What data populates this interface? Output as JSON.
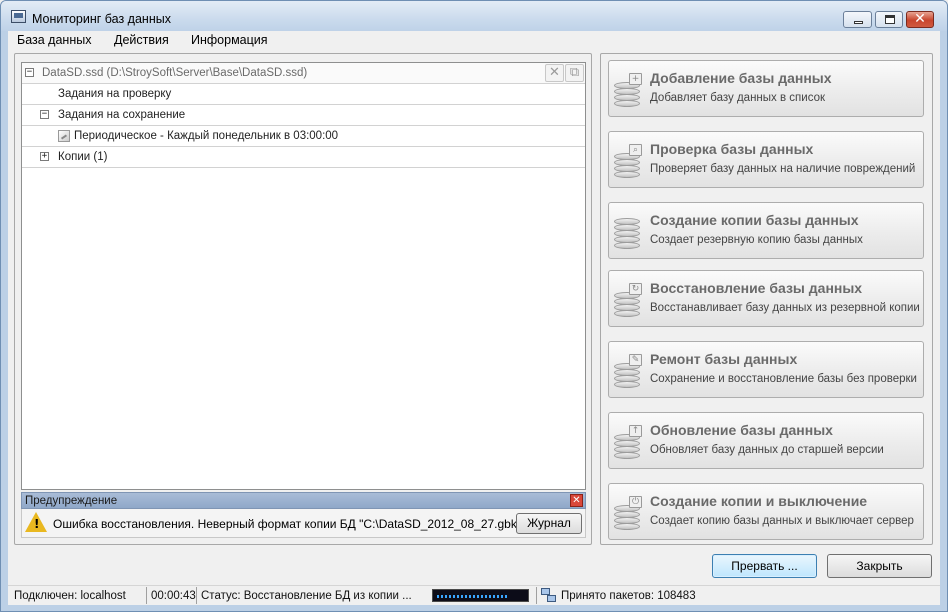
{
  "window": {
    "title": "Мониторинг баз данных",
    "close_glyph": "✕"
  },
  "menu": [
    "База данных",
    "Действия",
    "Информация"
  ],
  "tree": {
    "root": "DataSD.ssd (D:\\StroySoft\\Server\\Base\\DataSD.ssd)",
    "root_tools": [
      "✕",
      "⧉"
    ],
    "items": [
      "Задания на проверку",
      "Задания на сохранение",
      "Периодическое - Каждый понедельник в 03:00:00",
      "Копии (1)"
    ],
    "expander_minus": "−",
    "expander_plus": "+"
  },
  "warning": {
    "title": "Предупреждение",
    "close_glyph": "✕",
    "icon_mark": "!",
    "message": "Ошибка восстановления. Неверный формат копии БД \"C:\\DataSD_2012_08_27.gbk\"",
    "journal_button": "Журнал"
  },
  "actions": [
    {
      "title": "Добавление базы данных",
      "subtitle": "Добавляет базу данных в список",
      "badge": "+"
    },
    {
      "title": "Проверка базы данных",
      "subtitle": "Проверяет базу данных на наличие повреждений",
      "badge": "⌕"
    },
    {
      "title": "Создание копии базы данных",
      "subtitle": "Создает резервную копию базы данных",
      "badge": ""
    },
    {
      "title": "Восстановление базы данных",
      "subtitle": "Восстанавливает базу данных из резервной копии",
      "badge": "↻"
    },
    {
      "title": "Ремонт базы данных",
      "subtitle": "Сохранение и восстановление базы без проверки",
      "badge": "✎"
    },
    {
      "title": "Обновление базы данных",
      "subtitle": "Обновляет базу данных до старшей версии",
      "badge": "↑"
    },
    {
      "title": "Создание копии и выключение",
      "subtitle": "Создает копию базы данных и выключает сервер",
      "badge": "⏻"
    }
  ],
  "buttons": {
    "stop": "Прервать ...",
    "close": "Закрыть"
  },
  "status": {
    "connected": "Подключен: localhost",
    "elapsed": "00:00:43",
    "state": "Статус: Восстановление БД из копии ...",
    "packets": "Принято пакетов: 108483"
  }
}
